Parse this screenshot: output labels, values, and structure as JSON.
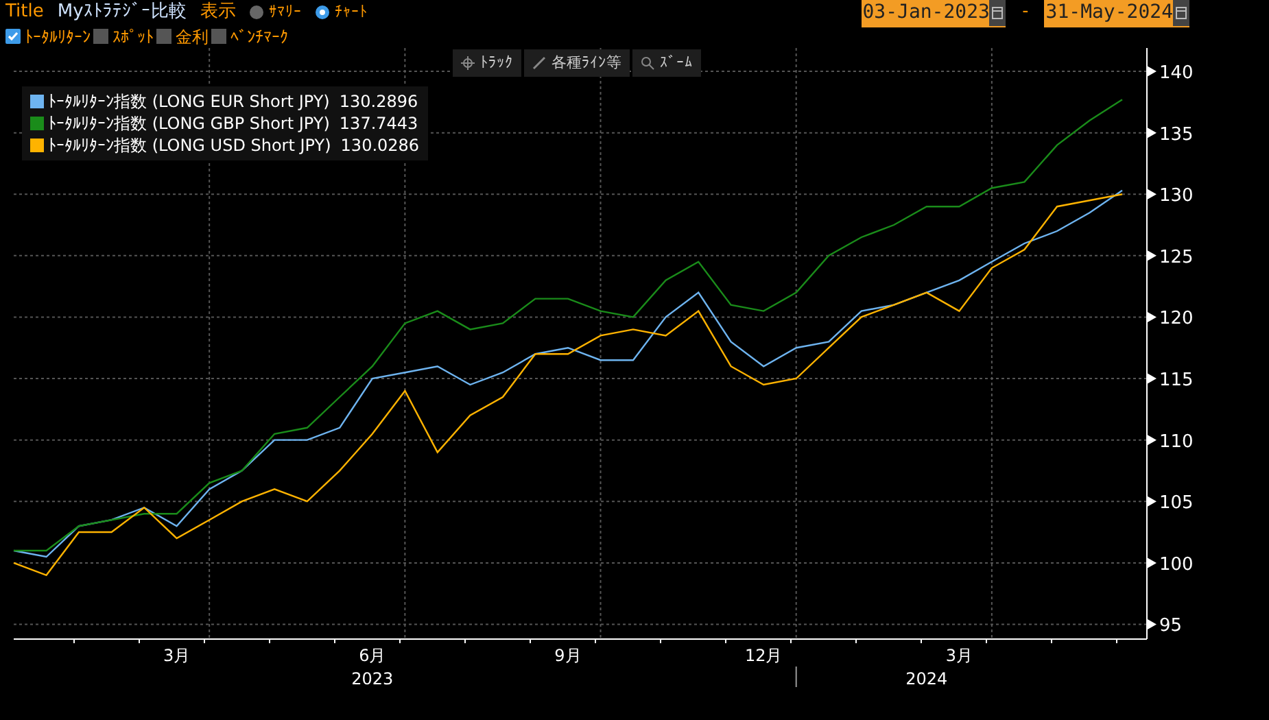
{
  "header": {
    "title_label": "Title",
    "title": "Myｽﾄﾗﾃｼﾞｰ比較",
    "view_label": "表示",
    "view_options": [
      {
        "label": "ｻﾏﾘｰ",
        "selected": false
      },
      {
        "label": "ﾁｬｰﾄ",
        "selected": true
      }
    ]
  },
  "filters": [
    {
      "label": "ﾄｰﾀﾙﾘﾀｰﾝ",
      "checked": true
    },
    {
      "label": "ｽﾎﾟｯﾄ",
      "checked": false
    },
    {
      "label": "金利",
      "checked": false
    },
    {
      "label": "ﾍﾞﾝﾁﾏｰｸ",
      "checked": false
    }
  ],
  "date_range": {
    "start": "03-Jan-2023",
    "separator": "-",
    "end": "31-May-2024"
  },
  "chart_tools": [
    {
      "kind": "track",
      "label": "ﾄﾗｯｸ"
    },
    {
      "kind": "line",
      "label": "各種ﾗｲﾝ等"
    },
    {
      "kind": "zoom",
      "label": "ｽﾞｰﾑ"
    }
  ],
  "legend_values": [
    "130.2896",
    "137.7443",
    "130.0286"
  ],
  "chart": {
    "year_labels": [
      "2023",
      "2024"
    ],
    "chart_data": {
      "type": "line",
      "categories": [
        null,
        null,
        null,
        null,
        null,
        "3月",
        null,
        null,
        null,
        null,
        null,
        "6月",
        null,
        null,
        null,
        null,
        null,
        "9月",
        null,
        null,
        null,
        null,
        null,
        "12月",
        null,
        null,
        null,
        null,
        null,
        "3月",
        null,
        null,
        null,
        null,
        null
      ],
      "grid": true,
      "series": [
        {
          "name": "ﾄｰﾀﾙﾘﾀｰﾝ指数 (LONG EUR Short JPY)",
          "color": "#6eb4f0",
          "values": [
            101,
            100.5,
            103,
            103.5,
            104.5,
            103,
            106,
            107.5,
            110,
            110,
            111,
            115,
            115.5,
            116,
            114.5,
            115.5,
            117,
            117.5,
            116.5,
            116.5,
            120,
            122,
            118,
            116,
            117.5,
            118,
            120.5,
            121,
            122,
            123,
            124.5,
            126,
            127,
            128.5,
            130.3
          ]
        },
        {
          "name": "ﾄｰﾀﾙﾘﾀｰﾝ指数 (LONG GBP Short JPY)",
          "color": "#1a8c1a",
          "values": [
            101,
            101,
            103,
            103.5,
            104,
            104,
            106.5,
            107.5,
            110.5,
            111,
            113.5,
            116,
            119.5,
            120.5,
            119,
            119.5,
            121.5,
            121.5,
            120.5,
            120,
            123,
            124.5,
            121,
            120.5,
            122,
            125,
            126.5,
            127.5,
            129,
            129,
            130.5,
            131,
            134,
            136,
            137.7
          ]
        },
        {
          "name": "ﾄｰﾀﾙﾘﾀｰﾝ指数 (LONG USD Short JPY)",
          "color": "#ffb300",
          "values": [
            100,
            99,
            102.5,
            102.5,
            104.5,
            102,
            103.5,
            105,
            106,
            105,
            107.5,
            110.5,
            114,
            109,
            112,
            113.5,
            117,
            117,
            118.5,
            119,
            118.5,
            120.5,
            116,
            114.5,
            115,
            117.5,
            120,
            121,
            122,
            120.5,
            124,
            125.5,
            129,
            129.5,
            130
          ]
        }
      ],
      "ylim": [
        93.8,
        141.9
      ],
      "yticks": [
        95,
        100,
        105,
        110,
        115,
        120,
        125,
        130,
        135,
        140
      ]
    }
  }
}
